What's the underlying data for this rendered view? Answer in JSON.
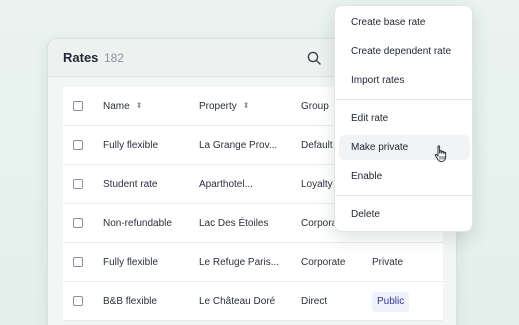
{
  "table": {
    "title": "Rates",
    "count": "182",
    "columns": {
      "name": "Name",
      "property": "Property",
      "group": "Group"
    },
    "rows": [
      {
        "name": "Fully flexible",
        "property": "La Grange Prov...",
        "group": "Default",
        "visibility": ""
      },
      {
        "name": "Student rate",
        "property": "Aparthotel...",
        "group": "Loyalty",
        "visibility": ""
      },
      {
        "name": "Non-refundable",
        "property": "Lac Des Étoiles",
        "group": "Corporate",
        "visibility": ""
      },
      {
        "name": "Fully flexible",
        "property": "Le Refuge Paris...",
        "group": "Corporate",
        "visibility": "Private"
      },
      {
        "name": "B&B flexible",
        "property": "Le Château Doré",
        "group": "Direct",
        "visibility": "Public"
      }
    ]
  },
  "menu": {
    "items": [
      "Create base rate",
      "Create dependent rate",
      "Import rates",
      "Edit rate",
      "Make private",
      "Enable",
      "Delete"
    ],
    "hovered_index": 4
  },
  "icons": {
    "search": "search-icon",
    "sort": "sort-icon",
    "cursor": "hand-pointer-icon"
  }
}
